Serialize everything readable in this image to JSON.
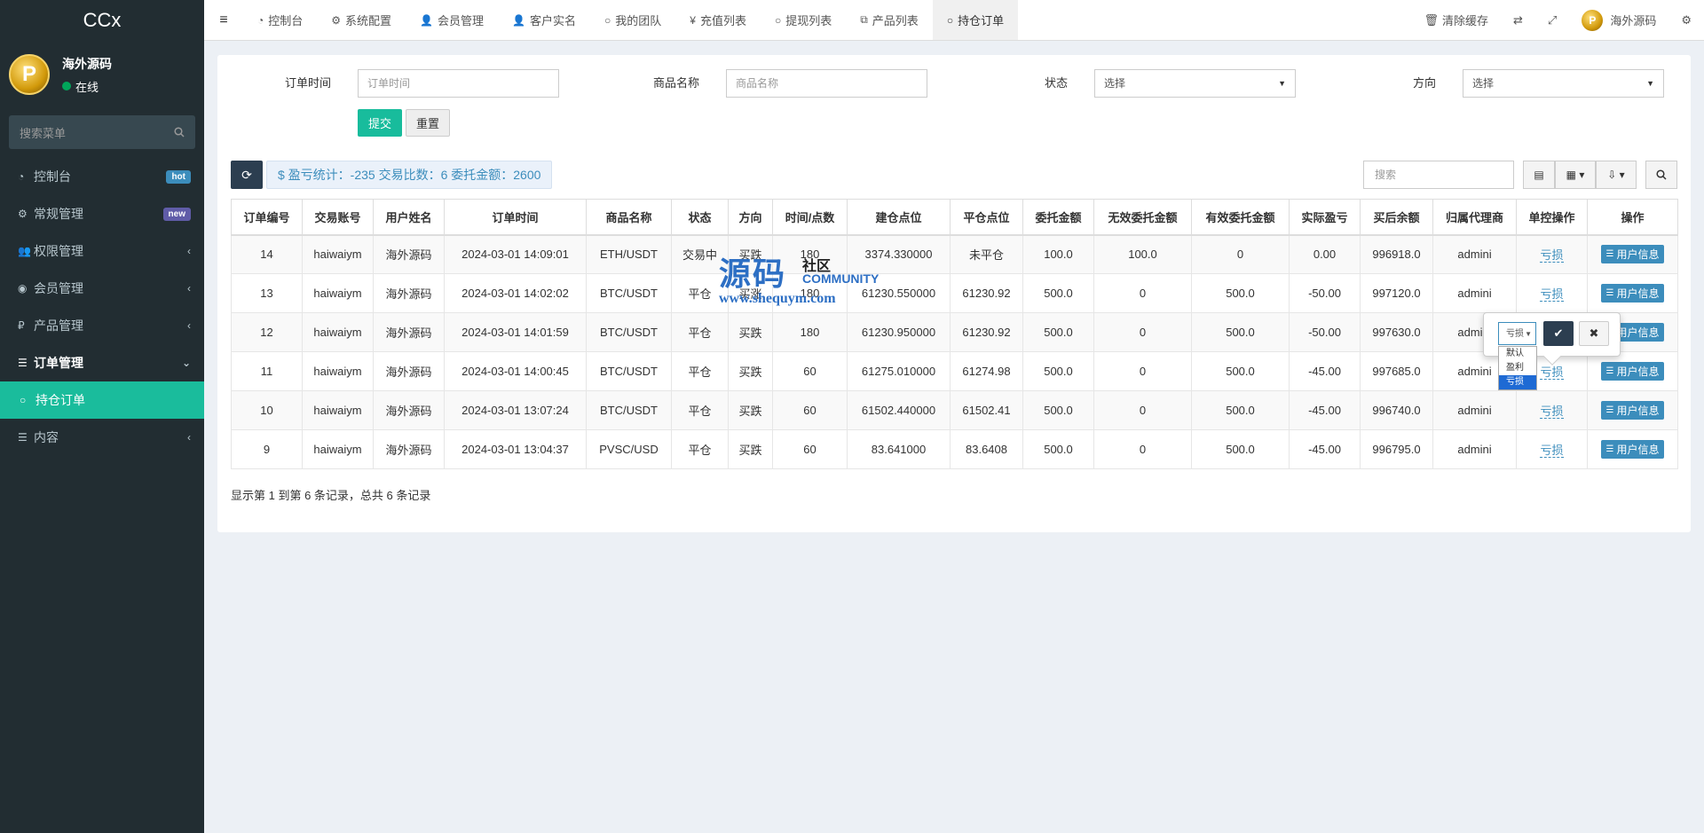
{
  "app": {
    "title": "CCx"
  },
  "user": {
    "name": "海外源码",
    "status": "在线",
    "avatar_letter": "P"
  },
  "sidebar": {
    "search_placeholder": "搜索菜单",
    "items": [
      {
        "label": "控制台",
        "icon": "dashboard-icon",
        "badge": "hot"
      },
      {
        "label": "常规管理",
        "icon": "cogs-icon",
        "badge": "new"
      },
      {
        "label": "权限管理",
        "icon": "group-icon"
      },
      {
        "label": "会员管理",
        "icon": "user-circle-icon"
      },
      {
        "label": "产品管理",
        "icon": "ruble-icon"
      },
      {
        "label": "订单管理",
        "icon": "list-icon"
      },
      {
        "label": "持仓订单",
        "icon": "circle-icon"
      },
      {
        "label": "内容",
        "icon": "list-icon"
      }
    ]
  },
  "topnav": {
    "tabs": [
      "控制台",
      "系统配置",
      "会员管理",
      "客户实名",
      "我的团队",
      "充值列表",
      "提现列表",
      "产品列表",
      "持仓订单"
    ],
    "clear_cache": "清除缓存",
    "user_name": "海外源码"
  },
  "filters": {
    "order_time_label": "订单时间",
    "order_time_placeholder": "订单时间",
    "product_label": "商品名称",
    "product_placeholder": "商品名称",
    "status_label": "状态",
    "status_value": "选择",
    "direction_label": "方向",
    "direction_value": "选择",
    "submit": "提交",
    "reset": "重置"
  },
  "toolbar": {
    "stats": "$ 盈亏统计：-235 交易比数：6 委托金额：2600",
    "search_placeholder": "搜索"
  },
  "table": {
    "headers": [
      "订单编号",
      "交易账号",
      "用户姓名",
      "订单时间",
      "商品名称",
      "状态",
      "方向",
      "时间/点数",
      "建仓点位",
      "平仓点位",
      "委托金额",
      "无效委托金额",
      "有效委托金额",
      "实际盈亏",
      "买后余额",
      "归属代理商",
      "单控操作",
      "操作"
    ],
    "rows": [
      [
        "14",
        "haiwaiym",
        "海外源码",
        "2024-03-01 14:09:01",
        "ETH/USDT",
        "交易中",
        "买跌",
        "180",
        "3374.330000",
        "未平仓",
        "100.0",
        "100.0",
        "0",
        "0.00",
        "996918.0",
        "admini",
        "亏损",
        "用户信息"
      ],
      [
        "13",
        "haiwaiym",
        "海外源码",
        "2024-03-01 14:02:02",
        "BTC/USDT",
        "平仓",
        "买涨",
        "180",
        "61230.550000",
        "61230.92",
        "500.0",
        "0",
        "500.0",
        "-50.00",
        "997120.0",
        "admini",
        "亏损",
        "用户信息"
      ],
      [
        "12",
        "haiwaiym",
        "海外源码",
        "2024-03-01 14:01:59",
        "BTC/USDT",
        "平仓",
        "买跌",
        "180",
        "61230.950000",
        "61230.92",
        "500.0",
        "0",
        "500.0",
        "-50.00",
        "997630.0",
        "admini",
        "亏损",
        "用户信息"
      ],
      [
        "11",
        "haiwaiym",
        "海外源码",
        "2024-03-01 14:00:45",
        "BTC/USDT",
        "平仓",
        "买跌",
        "60",
        "61275.010000",
        "61274.98",
        "500.0",
        "0",
        "500.0",
        "-45.00",
        "997685.0",
        "admini",
        "亏损",
        "用户信息"
      ],
      [
        "10",
        "haiwaiym",
        "海外源码",
        "2024-03-01 13:07:24",
        "BTC/USDT",
        "平仓",
        "买跌",
        "60",
        "61502.440000",
        "61502.41",
        "500.0",
        "0",
        "500.0",
        "-45.00",
        "996740.0",
        "admini",
        "亏损",
        "用户信息"
      ],
      [
        "9",
        "haiwaiym",
        "海外源码",
        "2024-03-01 13:04:37",
        "PVSC/USD",
        "平仓",
        "买跌",
        "60",
        "83.641000",
        "83.6408",
        "500.0",
        "0",
        "500.0",
        "-45.00",
        "996795.0",
        "admini",
        "亏损",
        "用户信息"
      ]
    ]
  },
  "pagination": {
    "text": "显示第 1 到第 6 条记录，总共 6 条记录"
  },
  "popover": {
    "select_value": "亏损",
    "options": [
      "默认",
      "盈利",
      "亏损"
    ],
    "selected_option": "亏损"
  },
  "watermark": {
    "main": "源码",
    "sub": "社区",
    "community": "COMMUNITY",
    "url": "www.shequym.com"
  },
  "colors": {
    "sidebar_bg": "#222d32",
    "accent": "#18bc9c",
    "primary": "#3c8dbc",
    "loss": "#e3001b",
    "gain": "#18a52a"
  }
}
